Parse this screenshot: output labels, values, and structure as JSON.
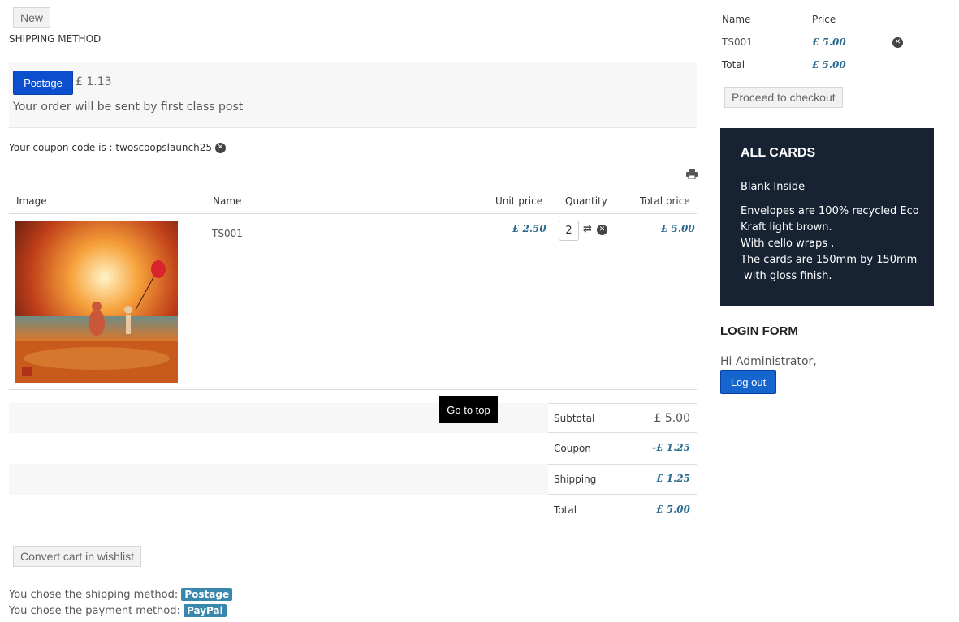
{
  "top": {
    "new_label": "New",
    "shipping_heading": "SHIPPING METHOD"
  },
  "shipping": {
    "button_label": "Postage",
    "price": "£ 1.13",
    "description": "Your order will be sent by first class post"
  },
  "coupon": {
    "text": "Your coupon code is : twoscoopslaunch25"
  },
  "cart_table": {
    "headers": [
      "Image",
      "Name",
      "Unit price",
      "Quantity",
      "Total price"
    ],
    "row": {
      "name": "TS001",
      "unit_price": "£ 2.50",
      "quantity": "2",
      "total_price": "£ 5.00"
    }
  },
  "go_to_top": "Go to top",
  "totals": {
    "subtotal_label": "Subtotal",
    "subtotal_value": "£ 5.00",
    "coupon_label": "Coupon",
    "coupon_value": "-£ 1.25",
    "shipping_label": "Shipping",
    "shipping_value": "£ 1.25",
    "total_label": "Total",
    "total_value": "£ 5.00"
  },
  "wishlist_label": "Convert cart in wishlist",
  "chosen": {
    "shipping_text": "You chose the shipping method:",
    "shipping_badge": "Postage",
    "payment_text": "You chose the payment method:",
    "payment_badge": "PayPal"
  },
  "mini_cart": {
    "name_header": "Name",
    "price_header": "Price",
    "item_name": "TS001",
    "item_price": "£ 5.00",
    "total_label": "Total",
    "total_price": "£ 5.00",
    "checkout_label": "Proceed to checkout"
  },
  "all_cards": {
    "title": "ALL CARDS",
    "line1": "Blank Inside",
    "line2": "Envelopes are 100% recycled Eco",
    "line3": "Kraft light brown.",
    "line4": "With cello wraps .",
    "line5": "The cards are 150mm by 150mm",
    "line6": " with gloss finish."
  },
  "login": {
    "title": "LOGIN FORM",
    "greeting": "Hi Administrator,",
    "logout_label": "Log out"
  },
  "colors": {
    "accent_blue": "#0b4fcf",
    "money_blue": "#2b6a8f",
    "panel_dark": "#172233",
    "badge_blue": "#3a87ad"
  }
}
